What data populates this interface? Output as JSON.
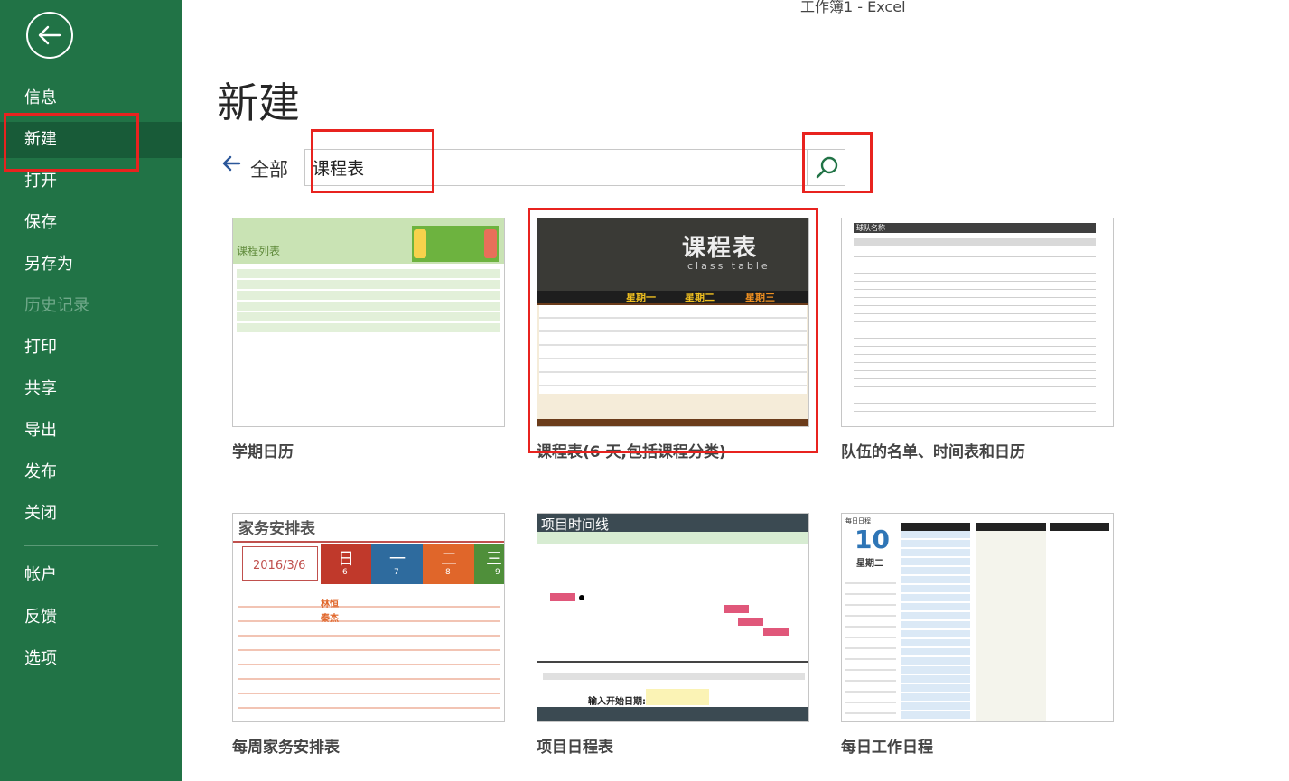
{
  "window": {
    "title": "工作簿1  -  Excel"
  },
  "colors": {
    "excel_green": "#217346",
    "active_nav": "#185b38",
    "highlight_red": "#e8231f",
    "accent_blue": "#2b579a"
  },
  "sidebar": {
    "back_icon": "back-arrow-circle-icon",
    "items": [
      {
        "label": "信息"
      },
      {
        "label": "新建"
      },
      {
        "label": "打开"
      },
      {
        "label": "保存"
      },
      {
        "label": "另存为"
      },
      {
        "label": "历史记录"
      },
      {
        "label": "打印"
      },
      {
        "label": "共享"
      },
      {
        "label": "导出"
      },
      {
        "label": "发布"
      },
      {
        "label": "关闭"
      },
      {
        "label": "帐户"
      },
      {
        "label": "反馈"
      },
      {
        "label": "选项"
      }
    ]
  },
  "main": {
    "title": "新建",
    "breadcrumb": {
      "back_icon": "left-arrow-icon",
      "label": "全部"
    },
    "search": {
      "value": "课程表",
      "icon": "search-icon"
    }
  },
  "templates": [
    {
      "label": "学期日历",
      "thumb_title": "课程列表"
    },
    {
      "label": "课程表(6 天,包括课程分类)",
      "thumb_title": "课程表",
      "thumb_subtitle": "class table",
      "days": [
        "星期一",
        "星期二",
        "星期三"
      ]
    },
    {
      "label": "队伍的名单、时间表和日历",
      "thumb_title": "球队名称"
    },
    {
      "label": "每周家务安排表",
      "thumb_title": "家务安排表",
      "thumb_date": "2016/3/6",
      "days": [
        "日",
        "一",
        "二",
        "三"
      ],
      "day_nums": [
        "6",
        "7",
        "8",
        "9"
      ],
      "names": [
        "林恒",
        "秦杰"
      ]
    },
    {
      "label": "项目日程表",
      "thumb_title": "项目时间线",
      "thumb_input_label": "输入开始日期:"
    },
    {
      "label": "每日工作日程",
      "thumb_title": "每日日程",
      "thumb_day": "10",
      "thumb_weekday": "星期二"
    }
  ]
}
